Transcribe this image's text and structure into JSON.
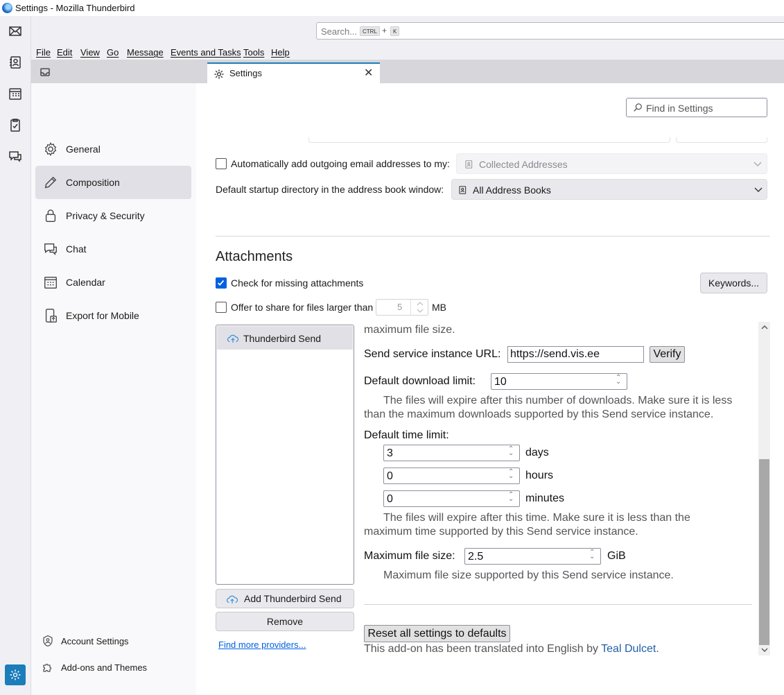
{
  "window": {
    "title": "Settings - Mozilla Thunderbird"
  },
  "search": {
    "placeholder": "Search...",
    "key1": "CTRL",
    "plus": "+",
    "key2": "K"
  },
  "menu": [
    "File",
    "Edit",
    "View",
    "Go",
    "Message",
    "Events and Tasks",
    "Tools",
    "Help"
  ],
  "tab": {
    "label": "Settings",
    "close": "✕"
  },
  "sidebar": {
    "items": [
      {
        "label": "General",
        "icon": "gear-icon"
      },
      {
        "label": "Composition",
        "icon": "pencil-icon",
        "selected": true
      },
      {
        "label": "Privacy & Security",
        "icon": "lock-icon"
      },
      {
        "label": "Chat",
        "icon": "chat-icon"
      },
      {
        "label": "Calendar",
        "icon": "calendar-icon"
      },
      {
        "label": "Export for Mobile",
        "icon": "mobile-export-icon"
      }
    ],
    "footer": [
      {
        "label": "Account Settings",
        "icon": "account-icon"
      },
      {
        "label": "Add-ons and Themes",
        "icon": "puzzle-icon"
      }
    ]
  },
  "find_settings": {
    "placeholder": "Find in Settings"
  },
  "addressing": {
    "auto_add_label": "Automatically add outgoing email addresses to my:",
    "auto_add_checked": false,
    "auto_add_value": "Collected Addresses",
    "startup_dir_label": "Default startup directory in the address book window:",
    "startup_dir_value": "All Address Books"
  },
  "attachments": {
    "heading": "Attachments",
    "check_missing_label": "Check for missing attachments",
    "check_missing_checked": true,
    "keywords_button": "Keywords...",
    "offer_share_label": "Offer to share for files larger than",
    "offer_share_checked": false,
    "offer_share_value": "5",
    "offer_share_unit": "MB",
    "providers": [
      "Thunderbird Send"
    ],
    "add_button": "Add Thunderbird Send",
    "remove_button": "Remove",
    "find_more_link": "Find more providers..."
  },
  "send_panel": {
    "top_text": "maximum file size.",
    "url_label": "Send service instance URL:",
    "url_value": "https://send.vis.ee",
    "verify_button": "Verify",
    "download_limit_label": "Default download limit:",
    "download_limit_value": "10",
    "download_note_1": "The files will expire after this number of downloads. Make sure it is less",
    "download_note_2": "than the maximum downloads supported by this Send service instance.",
    "time_limit_label": "Default time limit:",
    "days_value": "3",
    "days_unit": "days",
    "hours_value": "0",
    "hours_unit": "hours",
    "minutes_value": "0",
    "minutes_unit": "minutes",
    "time_note_1": "The files will expire after this time. Make sure it is less than the",
    "time_note_2": "maximum time supported by this Send service instance.",
    "max_size_label": "Maximum file size:",
    "max_size_value": "2.5",
    "max_size_unit": "GiB",
    "max_size_note": "Maximum file size supported by this Send service instance.",
    "reset_button": "Reset all settings to defaults",
    "translated_prefix": "This add-on has been translated into English by",
    "translator": "Teal Dulcet",
    "translated_suffix": "."
  }
}
